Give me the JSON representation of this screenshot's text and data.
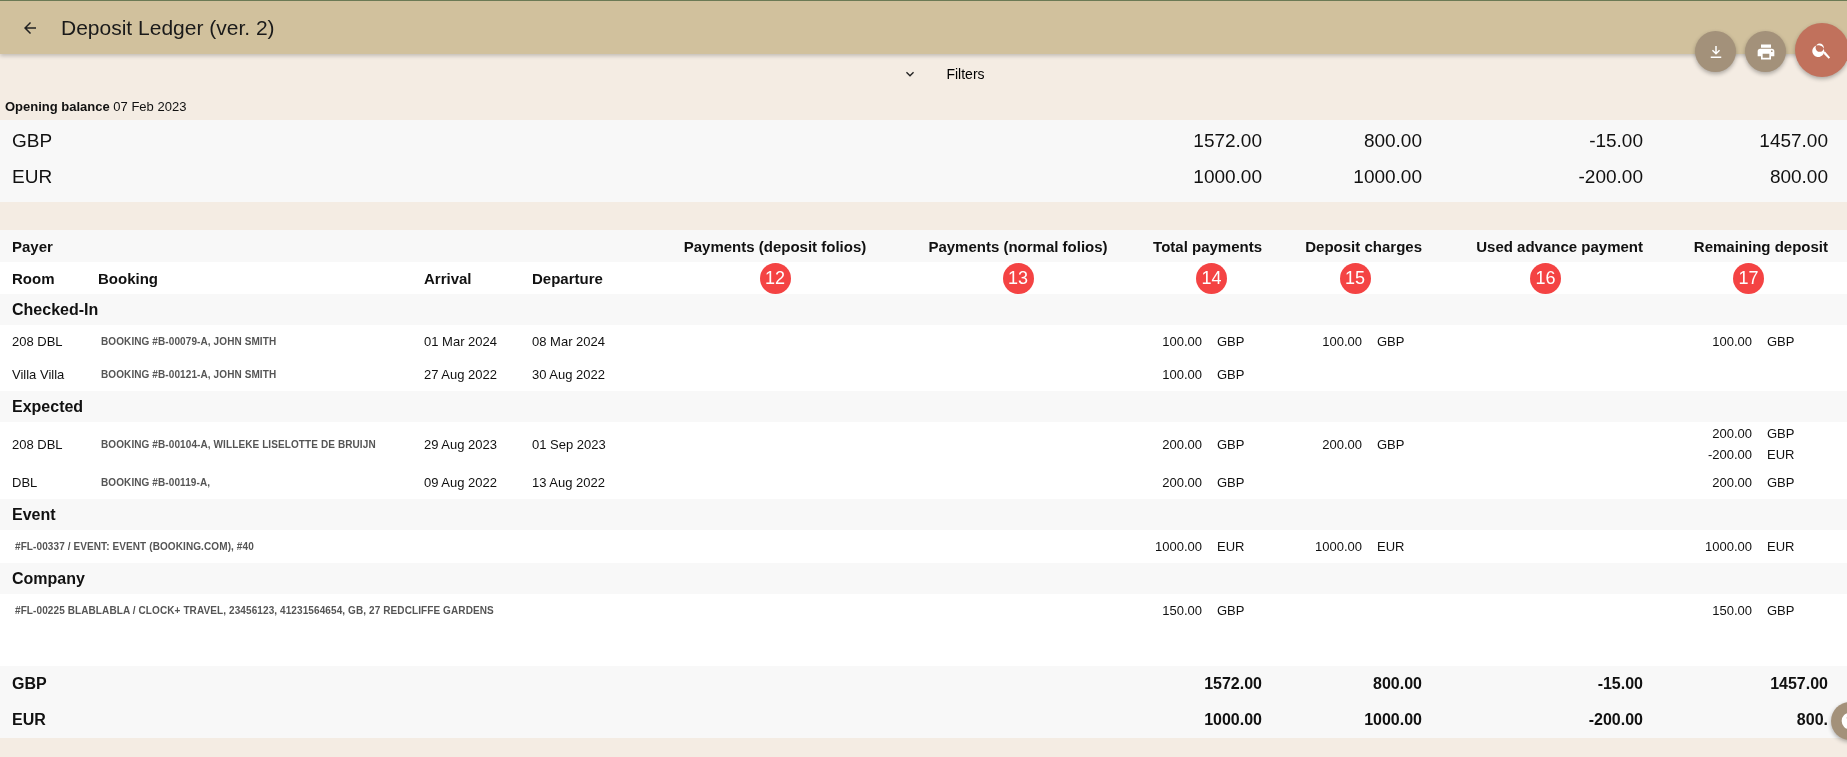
{
  "header": {
    "title": "Deposit Ledger (ver. 2)"
  },
  "filters": {
    "label": "Filters"
  },
  "opening_balance": {
    "label": "Opening balance",
    "date": "07 Feb 2023",
    "rows": [
      {
        "currency": "GBP",
        "values": [
          "1572.00",
          "800.00",
          "-15.00",
          "1457.00"
        ]
      },
      {
        "currency": "EUR",
        "values": [
          "1000.00",
          "1000.00",
          "-200.00",
          "800.00"
        ]
      }
    ]
  },
  "table": {
    "payer_label": "Payer",
    "columns": [
      "Room",
      "Booking",
      "Arrival",
      "Departure"
    ],
    "amount_columns": [
      {
        "title": "Payments (deposit folios)",
        "marker": "12"
      },
      {
        "title": "Payments (normal folios)",
        "marker": "13"
      },
      {
        "title": "Total payments",
        "marker": "14"
      },
      {
        "title": "Deposit charges",
        "marker": "15"
      },
      {
        "title": "Used advance payment",
        "marker": "16"
      },
      {
        "title": "Remaining deposit",
        "marker": "17"
      }
    ],
    "groups": [
      {
        "title": "Checked-In",
        "rows": [
          {
            "kind": "booking",
            "room": "208 DBL",
            "booking": "BOOKING #B-00079-A, JOHN SMITH",
            "arrival": "01 Mar 2024",
            "departure": "08 Mar 2024",
            "amounts": {
              "total": [
                {
                  "amount": "100.00",
                  "currency": "GBP"
                }
              ],
              "charges": [
                {
                  "amount": "100.00",
                  "currency": "GBP"
                }
              ],
              "remaining": [
                {
                  "amount": "100.00",
                  "currency": "GBP"
                }
              ]
            }
          },
          {
            "kind": "booking",
            "room": "Villa Villa",
            "booking": "BOOKING #B-00121-A, JOHN SMITH",
            "arrival": "27 Aug 2022",
            "departure": "30 Aug 2022",
            "amounts": {
              "total": [
                {
                  "amount": "100.00",
                  "currency": "GBP"
                }
              ]
            }
          }
        ]
      },
      {
        "title": "Expected",
        "rows": [
          {
            "kind": "booking",
            "room": "208 DBL",
            "booking": "BOOKING #B-00104-A, WILLEKE LISELOTTE DE BRUIJN",
            "arrival": "29 Aug 2023",
            "departure": "01 Sep 2023",
            "amounts": {
              "total": [
                {
                  "amount": "200.00",
                  "currency": "GBP"
                }
              ],
              "charges": [
                {
                  "amount": "200.00",
                  "currency": "GBP"
                }
              ],
              "remaining": [
                {
                  "amount": "200.00",
                  "currency": "GBP"
                },
                {
                  "amount": "-200.00",
                  "currency": "EUR"
                }
              ]
            }
          },
          {
            "kind": "booking",
            "room": "DBL",
            "booking": "BOOKING #B-00119-A,",
            "arrival": "09 Aug 2022",
            "departure": "13 Aug 2022",
            "amounts": {
              "total": [
                {
                  "amount": "200.00",
                  "currency": "GBP"
                }
              ],
              "remaining": [
                {
                  "amount": "200.00",
                  "currency": "GBP"
                }
              ]
            }
          }
        ]
      },
      {
        "title": "Event",
        "rows": [
          {
            "kind": "folio",
            "description": "#FL-00337 / EVENT: EVENT (BOOKING.COM), #40",
            "amounts": {
              "total": [
                {
                  "amount": "1000.00",
                  "currency": "EUR"
                }
              ],
              "charges": [
                {
                  "amount": "1000.00",
                  "currency": "EUR"
                }
              ],
              "remaining": [
                {
                  "amount": "1000.00",
                  "currency": "EUR"
                }
              ]
            }
          }
        ]
      },
      {
        "title": "Company",
        "rows": [
          {
            "kind": "folio",
            "description": "#FL-00225 BLABLABLA / CLOCK+ TRAVEL, 23456123, 41231564654, GB, 27 REDCLIFFE GARDENS",
            "amounts": {
              "total": [
                {
                  "amount": "150.00",
                  "currency": "GBP"
                }
              ],
              "remaining": [
                {
                  "amount": "150.00",
                  "currency": "GBP"
                }
              ]
            }
          }
        ]
      }
    ]
  },
  "totals": [
    {
      "currency": "GBP",
      "values": [
        "1572.00",
        "800.00",
        "-15.00",
        "1457.00"
      ]
    },
    {
      "currency": "EUR",
      "values": [
        "1000.00",
        "1000.00",
        "-200.00",
        "800."
      ]
    }
  ]
}
